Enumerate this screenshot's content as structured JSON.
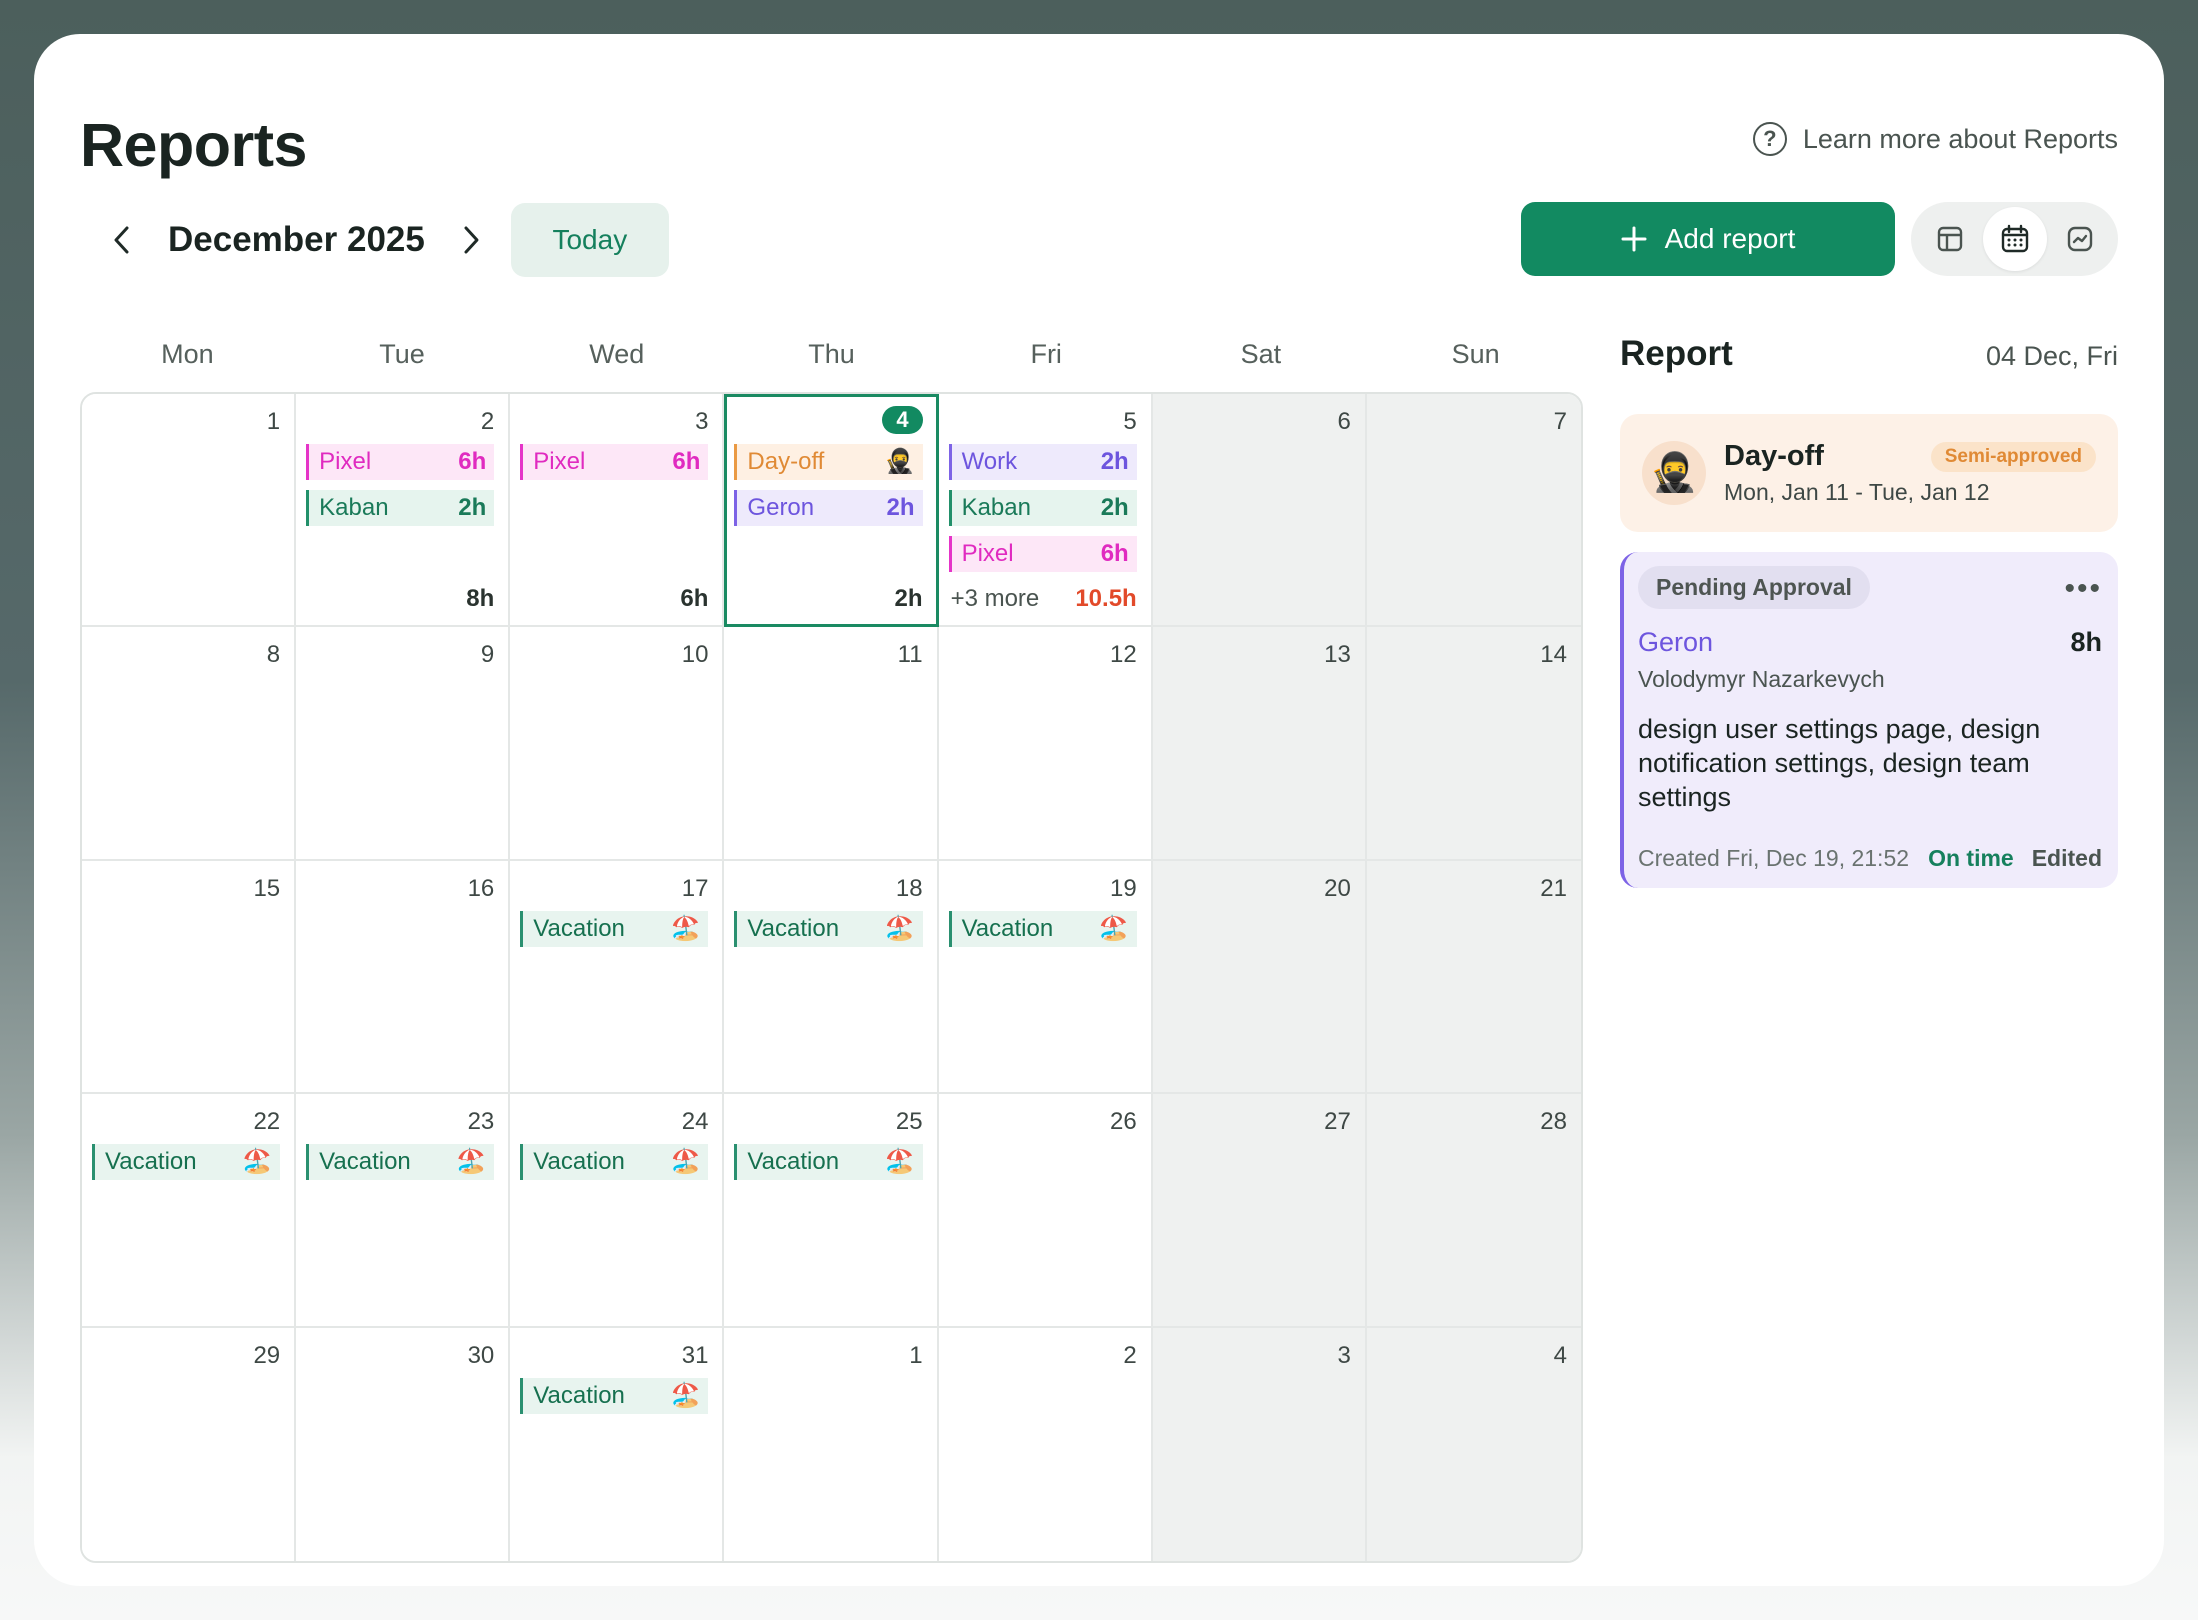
{
  "header": {
    "title": "Reports",
    "learn_more": "Learn more about Reports",
    "help_icon_glyph": "?"
  },
  "toolbar": {
    "month_label": "December 2025",
    "today_label": "Today",
    "add_report_label": "Add report",
    "view_modes": [
      "table-view",
      "calendar-view",
      "chart-view"
    ],
    "active_view": "calendar-view"
  },
  "calendar": {
    "weekdays": [
      "Mon",
      "Tue",
      "Wed",
      "Thu",
      "Fri",
      "Sat",
      "Sun"
    ],
    "weeks": [
      [
        {
          "day": "1",
          "entries": []
        },
        {
          "day": "2",
          "entries": [
            {
              "label": "Pixel",
              "value": "6h",
              "color": "pink"
            },
            {
              "label": "Kaban",
              "value": "2h",
              "color": "green"
            }
          ],
          "total": "8h"
        },
        {
          "day": "3",
          "entries": [
            {
              "label": "Pixel",
              "value": "6h",
              "color": "pink"
            }
          ],
          "total": "6h"
        },
        {
          "day": "4",
          "today": true,
          "entries": [
            {
              "label": "Day-off",
              "value": "🥷",
              "color": "orange"
            },
            {
              "label": "Geron",
              "value": "2h",
              "color": "purple"
            }
          ],
          "total": "2h"
        },
        {
          "day": "5",
          "entries": [
            {
              "label": "Work",
              "value": "2h",
              "color": "purple"
            },
            {
              "label": "Kaban",
              "value": "2h",
              "color": "green"
            },
            {
              "label": "Pixel",
              "value": "6h",
              "color": "pink"
            }
          ],
          "more": "+3 more",
          "total": "10.5h",
          "total_alert": true
        },
        {
          "day": "6",
          "entries": []
        },
        {
          "day": "7",
          "entries": []
        }
      ],
      [
        {
          "day": "8",
          "entries": []
        },
        {
          "day": "9",
          "entries": []
        },
        {
          "day": "10",
          "entries": []
        },
        {
          "day": "11",
          "entries": []
        },
        {
          "day": "12",
          "entries": []
        },
        {
          "day": "13",
          "entries": []
        },
        {
          "day": "14",
          "entries": []
        }
      ],
      [
        {
          "day": "15",
          "entries": []
        },
        {
          "day": "16",
          "entries": []
        },
        {
          "day": "17",
          "entries": [
            {
              "label": "Vacation",
              "value": "🏖️",
              "color": "vac"
            }
          ]
        },
        {
          "day": "18",
          "entries": [
            {
              "label": "Vacation",
              "value": "🏖️",
              "color": "vac"
            }
          ]
        },
        {
          "day": "19",
          "entries": [
            {
              "label": "Vacation",
              "value": "🏖️",
              "color": "vac"
            }
          ]
        },
        {
          "day": "20",
          "entries": []
        },
        {
          "day": "21",
          "entries": []
        }
      ],
      [
        {
          "day": "22",
          "entries": [
            {
              "label": "Vacation",
              "value": "🏖️",
              "color": "vac"
            }
          ]
        },
        {
          "day": "23",
          "entries": [
            {
              "label": "Vacation",
              "value": "🏖️",
              "color": "vac"
            }
          ]
        },
        {
          "day": "24",
          "entries": [
            {
              "label": "Vacation",
              "value": "🏖️",
              "color": "vac"
            }
          ]
        },
        {
          "day": "25",
          "entries": [
            {
              "label": "Vacation",
              "value": "🏖️",
              "color": "vac"
            }
          ]
        },
        {
          "day": "26",
          "entries": []
        },
        {
          "day": "27",
          "entries": []
        },
        {
          "day": "28",
          "entries": []
        }
      ],
      [
        {
          "day": "29",
          "entries": []
        },
        {
          "day": "30",
          "entries": []
        },
        {
          "day": "31",
          "entries": [
            {
              "label": "Vacation",
              "value": "🏖️",
              "color": "vac"
            }
          ]
        },
        {
          "day": "1",
          "entries": []
        },
        {
          "day": "2",
          "entries": []
        },
        {
          "day": "3",
          "entries": []
        },
        {
          "day": "4",
          "entries": []
        }
      ]
    ]
  },
  "panel": {
    "title": "Report",
    "date": "04 Dec, Fri",
    "dayoff": {
      "avatar": "🥷",
      "title": "Day-off",
      "dates": "Mon, Jan 11 - Tue, Jan 12",
      "status": "Semi-approved"
    },
    "pending": {
      "status": "Pending Approval",
      "menu": "•••",
      "project": "Geron",
      "hours": "8h",
      "person": "Volodymyr Nazarkevych",
      "description": "design user settings page, design notification settings, design team settings",
      "created": "Created Fri, Dec 19, 21:52",
      "timeliness": "On time",
      "edited": "Edited"
    }
  },
  "colors": {
    "accent": "#128a61",
    "pink": "#e02bc0",
    "green": "#1a7a59",
    "purple": "#6d55de",
    "orange": "#e08a35",
    "alert": "#e24a2a"
  }
}
